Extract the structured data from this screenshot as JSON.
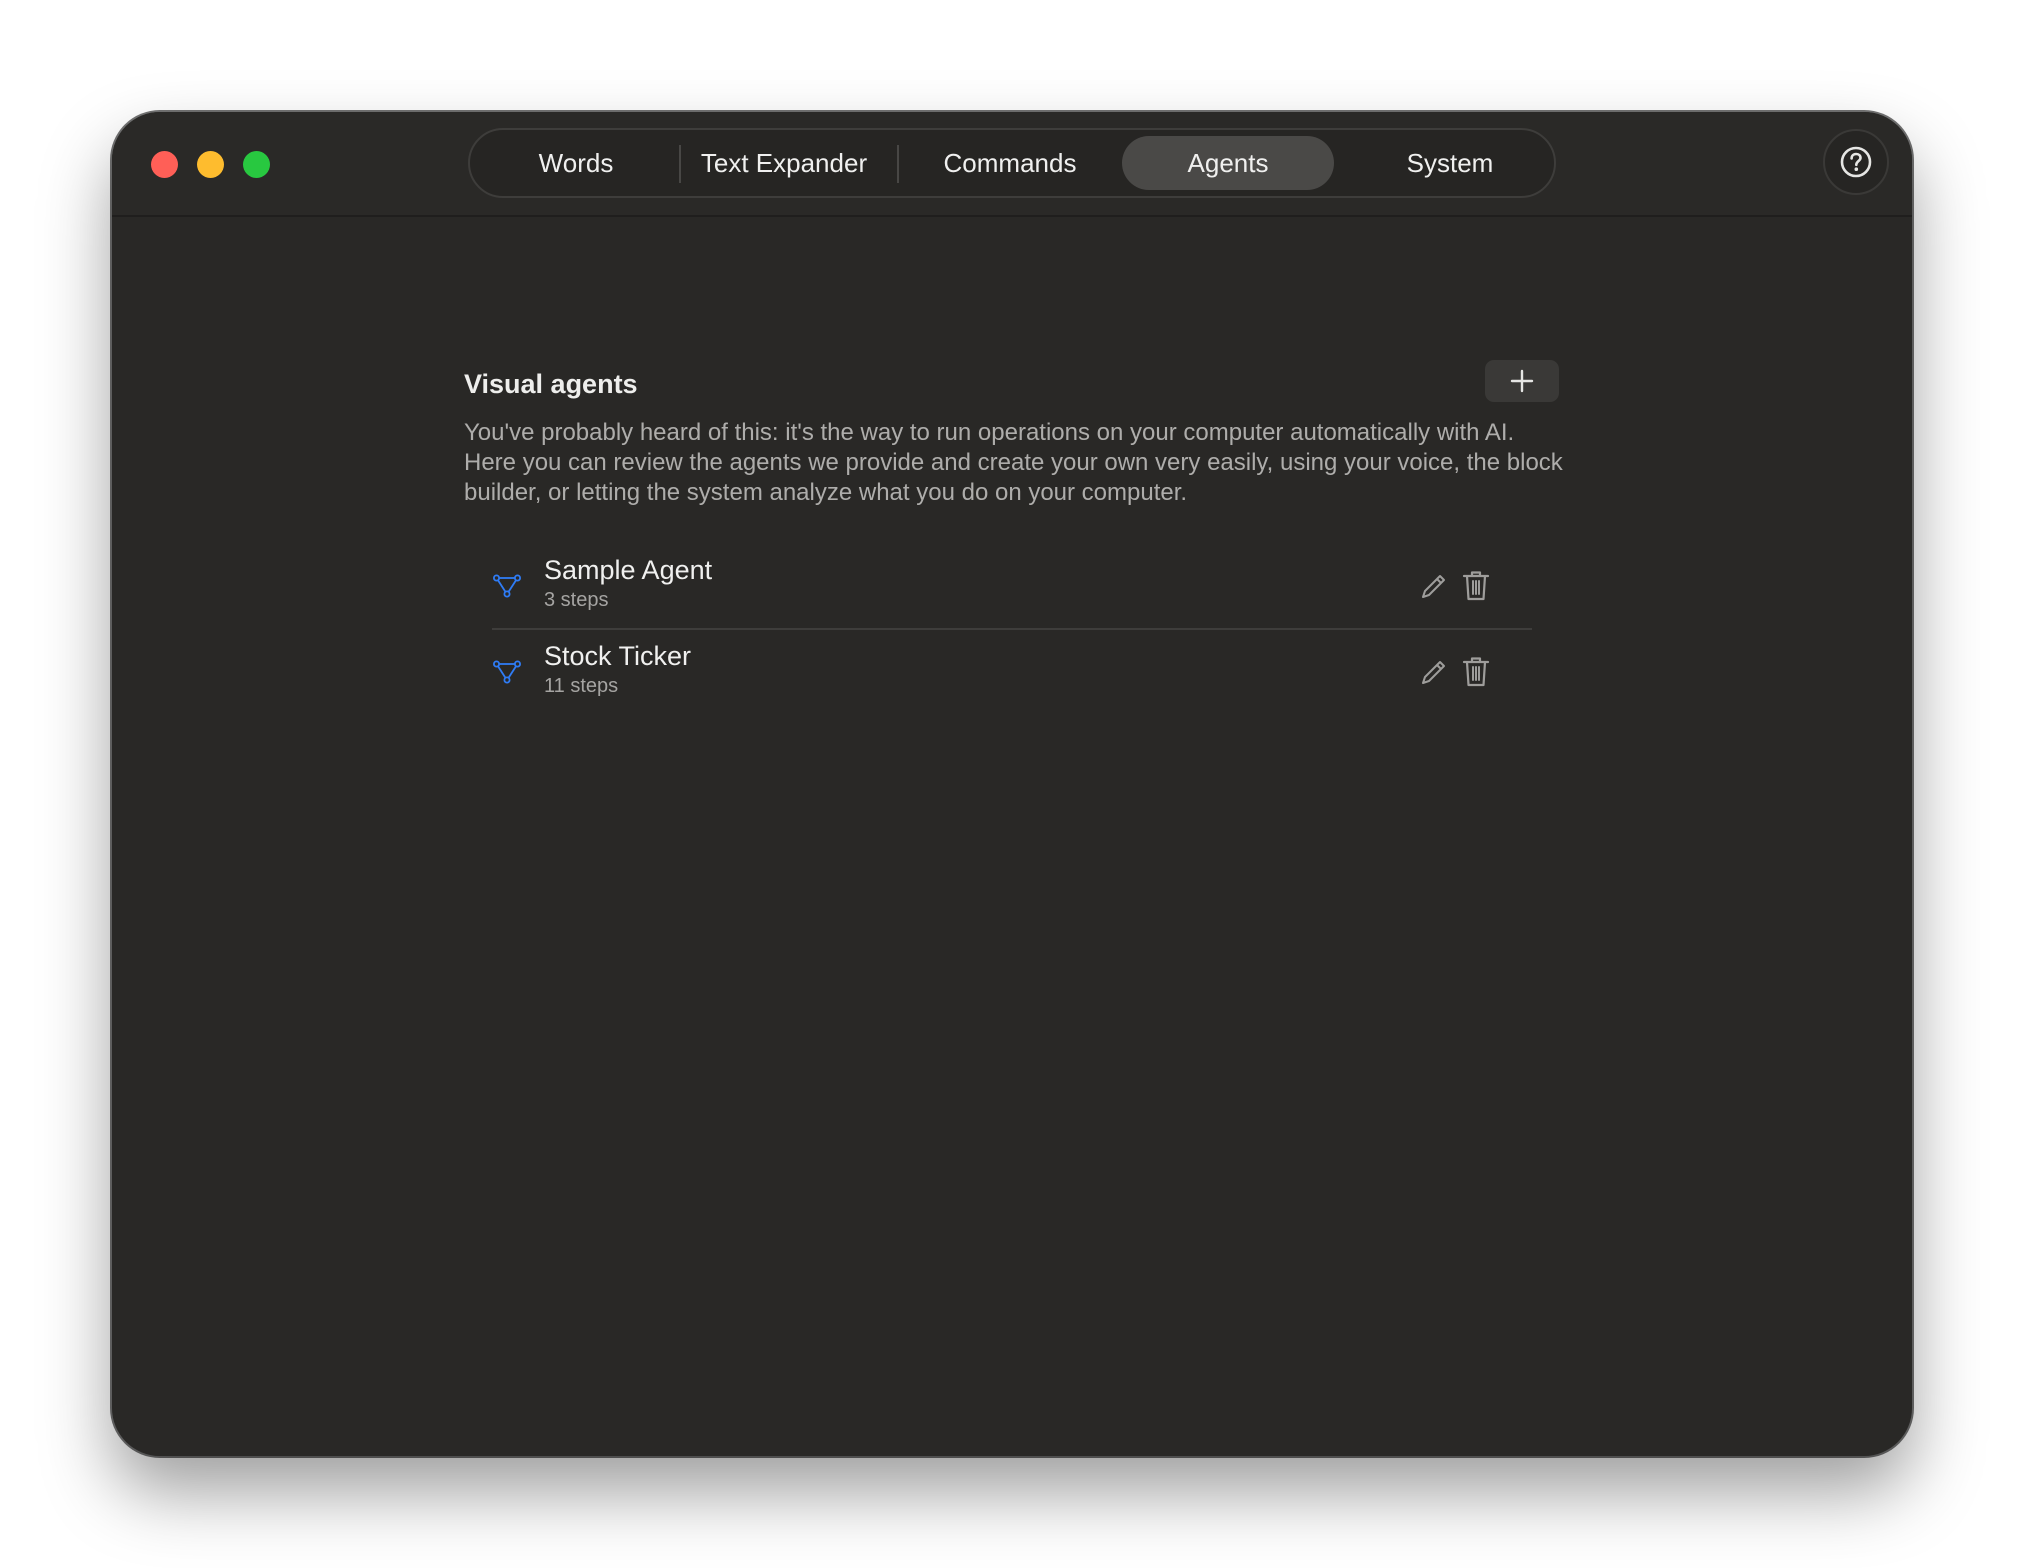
{
  "window": {
    "controls": [
      "close",
      "minimize",
      "maximize"
    ]
  },
  "tabs": [
    {
      "label": "Words",
      "active": false
    },
    {
      "label": "Text Expander",
      "active": false
    },
    {
      "label": "Commands",
      "active": false
    },
    {
      "label": "Agents",
      "active": true
    },
    {
      "label": "System",
      "active": false
    }
  ],
  "help": {
    "icon": "question-mark-icon"
  },
  "section": {
    "title": "Visual agents",
    "add_icon": "plus-icon",
    "description": "You've probably heard of this: it's the way to run operations on your computer automatically with AI. Here you can review the agents we provide and create your own very easily, using your voice, the block builder, or letting the system analyze what you do on your computer."
  },
  "agents": [
    {
      "name": "Sample Agent",
      "steps": "3 steps",
      "icon": "workflow-nodes-icon"
    },
    {
      "name": "Stock Ticker",
      "steps": "11 steps",
      "icon": "workflow-nodes-icon"
    }
  ],
  "colors": {
    "accent": "#2f7cf6",
    "window_bg": "#292826",
    "active_tab_bg": "#4a4947",
    "close": "#ff5f57",
    "minimize": "#febc2e",
    "maximize": "#28c840"
  }
}
